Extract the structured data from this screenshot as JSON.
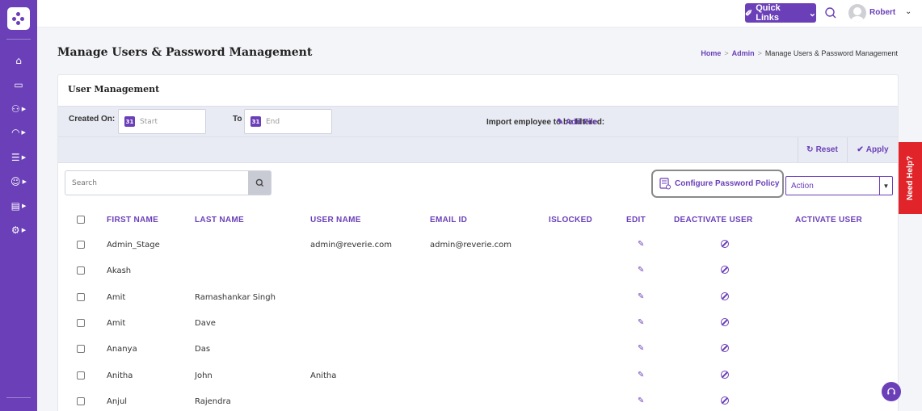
{
  "topbar": {
    "quick_links_label": "Quick Links",
    "username": "Robert"
  },
  "sidebar": {
    "items": [
      {
        "icon": "home-icon"
      },
      {
        "icon": "monitor-icon"
      },
      {
        "icon": "users-icon"
      },
      {
        "icon": "gauge-icon"
      },
      {
        "icon": "database-icon"
      },
      {
        "icon": "group-icon"
      },
      {
        "icon": "clipboard-icon"
      },
      {
        "icon": "settings-icon"
      }
    ]
  },
  "page": {
    "title": "Manage Users & Password Management",
    "breadcrumb": [
      "Home",
      "Admin",
      "Manage Users & Password Management"
    ]
  },
  "card": {
    "title": "User Management",
    "filters": {
      "created_on_label": "Created On:",
      "start_placeholder": "Start",
      "to_label": "To",
      "end_placeholder": "End",
      "import_label": "Import employee to be filtered:",
      "add_file_label": "Add File"
    },
    "actions": {
      "reset_label": "Reset",
      "apply_label": "Apply"
    },
    "search_placeholder": "Search",
    "configure_label": "Configure Password Policy",
    "action_select_value": "Action"
  },
  "table": {
    "headers": [
      "FIRST NAME",
      "LAST NAME",
      "USER NAME",
      "EMAIL ID",
      "ISLOCKED",
      "EDIT",
      "DEACTIVATE USER",
      "ACTIVATE USER"
    ],
    "rows": [
      {
        "first": "Admin_Stage",
        "last": "",
        "user": "admin@reverie.com",
        "email": "admin@reverie.com"
      },
      {
        "first": "Akash",
        "last": "",
        "user": "",
        "email": ""
      },
      {
        "first": "Amit",
        "last": "Ramashankar Singh",
        "user": "",
        "email": ""
      },
      {
        "first": "Amit",
        "last": "Dave",
        "user": "",
        "email": ""
      },
      {
        "first": "Ananya",
        "last": "Das",
        "user": "",
        "email": ""
      },
      {
        "first": "Anitha",
        "last": "John",
        "user": "Anitha",
        "email": ""
      },
      {
        "first": "Anjul",
        "last": "Rajendra",
        "user": "",
        "email": ""
      }
    ]
  },
  "help": {
    "need_help_label": "Need Help?"
  }
}
